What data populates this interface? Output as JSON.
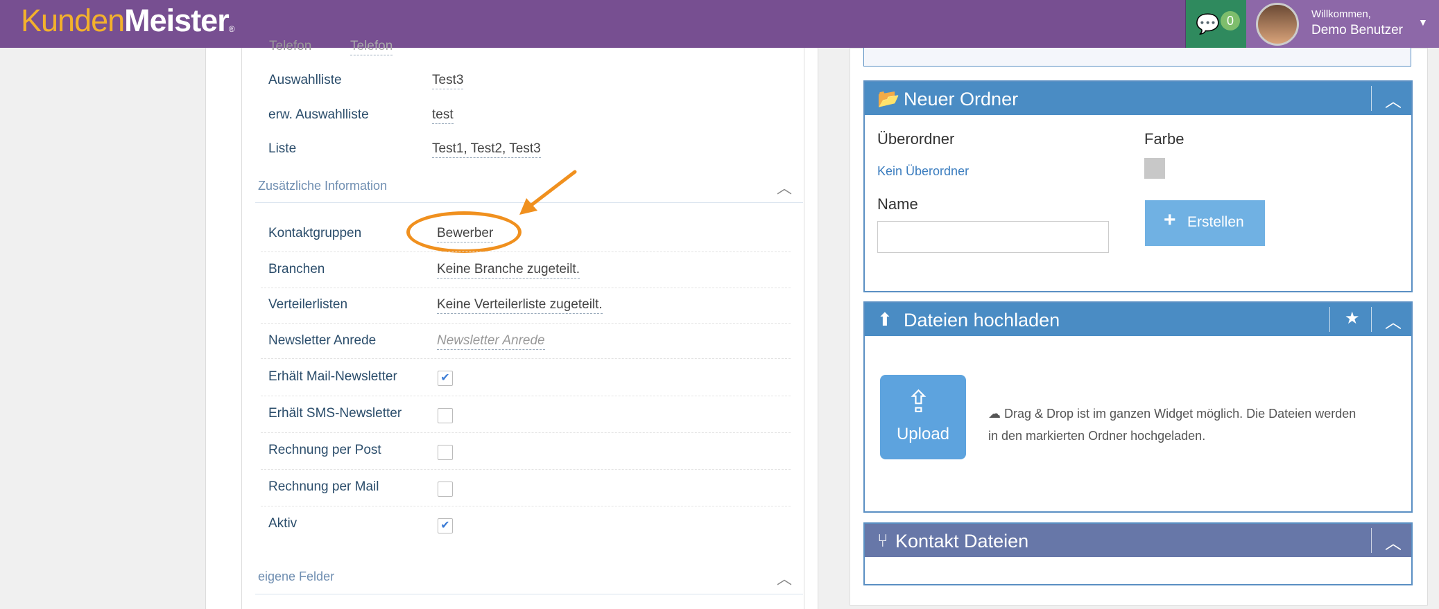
{
  "header": {
    "logo_part1": "Kunden",
    "logo_part2": "Meister",
    "logo_reg": "®",
    "messages_count": "0",
    "welcome": "Willkommen,",
    "user_name": "Demo Benutzer"
  },
  "details": {
    "partial_label": "Telefon",
    "partial_value": "Telefon",
    "fields_top": [
      {
        "label": "Auswahlliste",
        "value": "Test3"
      },
      {
        "label": "erw. Auswahlliste",
        "value": "test"
      },
      {
        "label": "Liste",
        "value": "Test1, Test2, Test3"
      }
    ],
    "section_zusatz": "Zusätzliche Information",
    "fields_zusatz": [
      {
        "label": "Kontaktgruppen",
        "value": "Bewerber"
      },
      {
        "label": "Branchen",
        "value": "Keine Branche zugeteilt."
      },
      {
        "label": "Verteilerlisten",
        "value": "Keine Verteilerliste zugeteilt."
      },
      {
        "label": "Newsletter Anrede",
        "placeholder": "Newsletter Anrede"
      }
    ],
    "checkboxes": [
      {
        "label": "Erhält Mail-Newsletter",
        "checked": true
      },
      {
        "label": "Erhält SMS-Newsletter",
        "checked": false
      },
      {
        "label": "Rechnung per Post",
        "checked": false
      },
      {
        "label": "Rechnung per Mail",
        "checked": false
      },
      {
        "label": "Aktiv",
        "checked": true
      }
    ],
    "section_eigene": "eigene Felder"
  },
  "new_folder": {
    "title": "Neuer Ordner",
    "parent_label": "Überordner",
    "parent_value": "Kein Überordner",
    "color_label": "Farbe",
    "name_label": "Name",
    "name_value": "",
    "create_label": "Erstellen"
  },
  "upload": {
    "title": "Dateien hochladen",
    "button_label": "Upload",
    "hint": "Drag & Drop ist im ganzen Widget möglich. Die Dateien werden in den markierten Ordner hochgeladen."
  },
  "contact_files": {
    "title": "Kontakt Dateien"
  },
  "colors": {
    "topbar": "#774f91",
    "accent_orange": "#f0901e",
    "widget_blue": "#4a8cc4",
    "widget_purple": "#6777a8"
  }
}
